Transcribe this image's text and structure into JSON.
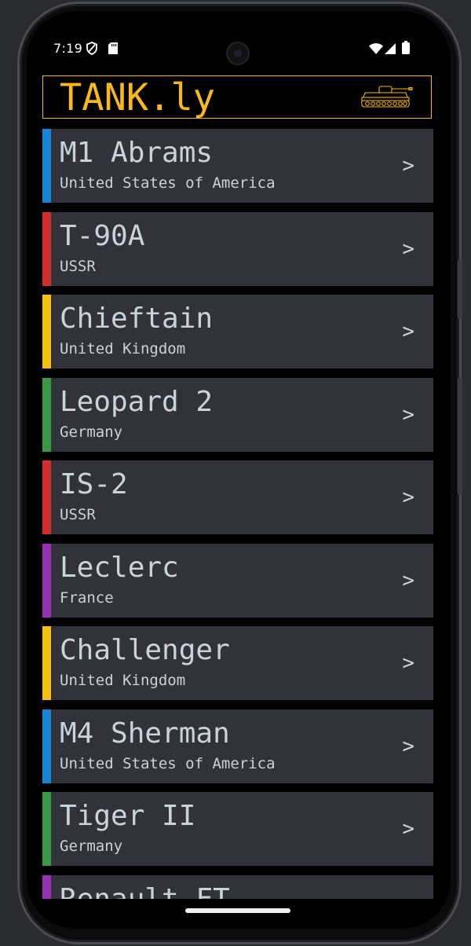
{
  "status_bar": {
    "time": "7:19",
    "icons": [
      "shield-icon",
      "sd-card-icon",
      "wifi-icon",
      "signal-icon",
      "battery-icon"
    ]
  },
  "header": {
    "title": "TANK.ly",
    "icon": "tank-icon",
    "accent_color": "#f9b91b"
  },
  "tanks": [
    {
      "name": "M1 Abrams",
      "country": "United States of America",
      "color": "#1585d6",
      "chevron": ">"
    },
    {
      "name": "T-90A",
      "country": "USSR",
      "color": "#d22e2e",
      "chevron": ">"
    },
    {
      "name": "Chieftain",
      "country": "United Kingdom",
      "color": "#f7c00c",
      "chevron": ">"
    },
    {
      "name": "Leopard 2",
      "country": "Germany",
      "color": "#3a9a44",
      "chevron": ">"
    },
    {
      "name": "IS-2",
      "country": "USSR",
      "color": "#d22e2e",
      "chevron": ">"
    },
    {
      "name": "Leclerc",
      "country": "France",
      "color": "#9b2fb5",
      "chevron": ">"
    },
    {
      "name": "Challenger",
      "country": "United Kingdom",
      "color": "#f7c00c",
      "chevron": ">"
    },
    {
      "name": "M4 Sherman",
      "country": "United States of America",
      "color": "#1585d6",
      "chevron": ">"
    },
    {
      "name": "Tiger II",
      "country": "Germany",
      "color": "#3a9a44",
      "chevron": ">"
    },
    {
      "name": "Renault FT",
      "country": "",
      "color": "#9b2fb5",
      "chevron": ">"
    }
  ]
}
